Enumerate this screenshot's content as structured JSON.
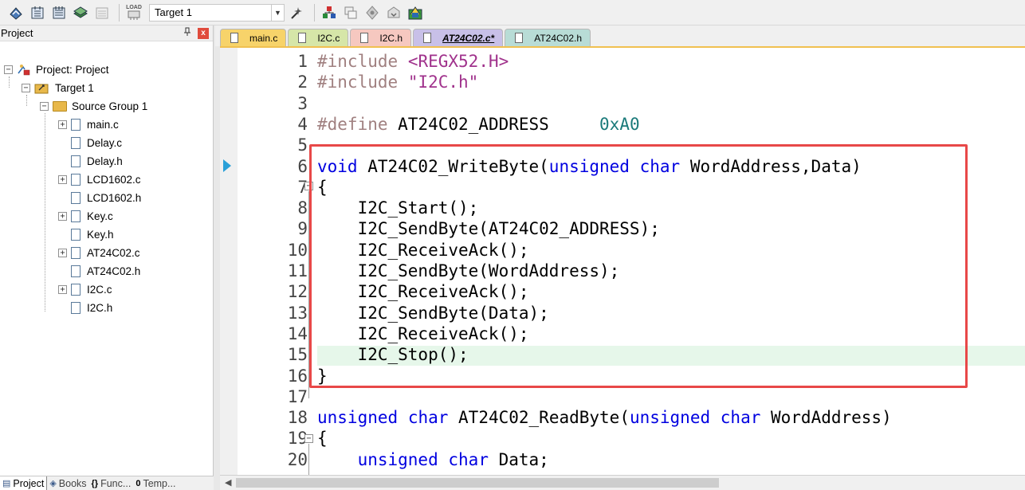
{
  "toolbar": {
    "target_value": "Target 1",
    "load_label": "LOAD"
  },
  "project_panel": {
    "title": "Project",
    "pin_glyph": "▪",
    "close_glyph": "x",
    "tree": {
      "project_label": "Project: Project",
      "target_label": "Target 1",
      "group_label": "Source Group 1",
      "files": [
        {
          "name": "main.c",
          "expandable": true
        },
        {
          "name": "Delay.c",
          "expandable": false
        },
        {
          "name": "Delay.h",
          "expandable": false
        },
        {
          "name": "LCD1602.c",
          "expandable": true
        },
        {
          "name": "LCD1602.h",
          "expandable": false
        },
        {
          "name": "Key.c",
          "expandable": true
        },
        {
          "name": "Key.h",
          "expandable": false
        },
        {
          "name": "AT24C02.c",
          "expandable": true
        },
        {
          "name": "AT24C02.h",
          "expandable": false
        },
        {
          "name": "I2C.c",
          "expandable": true
        },
        {
          "name": "I2C.h",
          "expandable": false
        }
      ]
    },
    "bottom_tabs": [
      {
        "label": "Project",
        "icon": "project-icon"
      },
      {
        "label": "Books",
        "icon": "books-icon"
      },
      {
        "label": "Func...",
        "icon": "functions-icon"
      },
      {
        "label": "Temp...",
        "icon": "templates-icon"
      }
    ]
  },
  "editor_tabs": [
    {
      "label": "main.c"
    },
    {
      "label": "I2C.c"
    },
    {
      "label": "I2C.h"
    },
    {
      "label": "AT24C02.c*"
    },
    {
      "label": "AT24C02.h"
    }
  ],
  "editor": {
    "line_numbers": [
      "1",
      "2",
      "3",
      "4",
      "5",
      "6",
      "7",
      "8",
      "9",
      "10",
      "11",
      "12",
      "13",
      "14",
      "15",
      "16",
      "17",
      "18",
      "19",
      "20"
    ],
    "lines": [
      "#include <REGX52.H>",
      "#include \"I2C.h\"",
      "",
      "#define AT24C02_ADDRESS     0xA0",
      "",
      "void AT24C02_WriteByte(unsigned char WordAddress,Data)",
      "{",
      "    I2C_Start();",
      "    I2C_SendByte(AT24C02_ADDRESS);",
      "    I2C_ReceiveAck();",
      "    I2C_SendByte(WordAddress);",
      "    I2C_ReceiveAck();",
      "    I2C_SendByte(Data);",
      "    I2C_ReceiveAck();",
      "    I2C_Stop();",
      "}",
      "",
      "unsigned char AT24C02_ReadByte(unsigned char WordAddress)",
      "{",
      "    unsigned char Data;"
    ],
    "current_line": 15,
    "highlight_color": "#e84848"
  }
}
